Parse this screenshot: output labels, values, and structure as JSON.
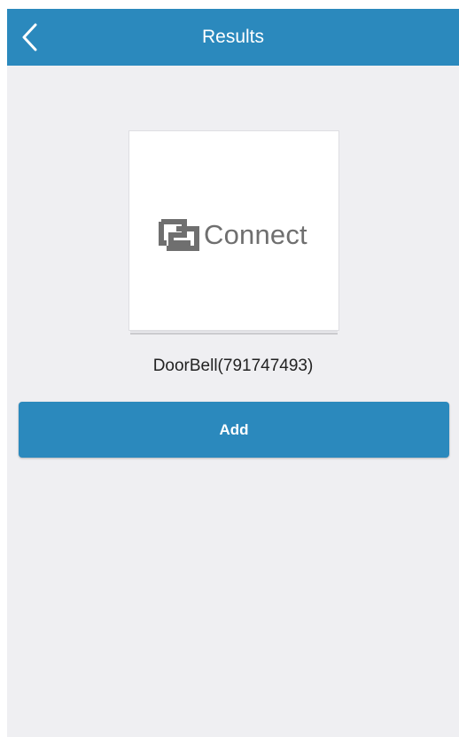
{
  "header": {
    "title": "Results",
    "back_icon": "chevron-left-icon"
  },
  "device": {
    "logo_icon": "connect-logo-icon",
    "logo_text": "Connect",
    "name": "DoorBell(791747493)"
  },
  "actions": {
    "add_label": "Add"
  },
  "colors": {
    "accent": "#2b89bd",
    "background": "#efeff2",
    "card": "#ffffff",
    "logo_gray": "#6f6f6f"
  }
}
